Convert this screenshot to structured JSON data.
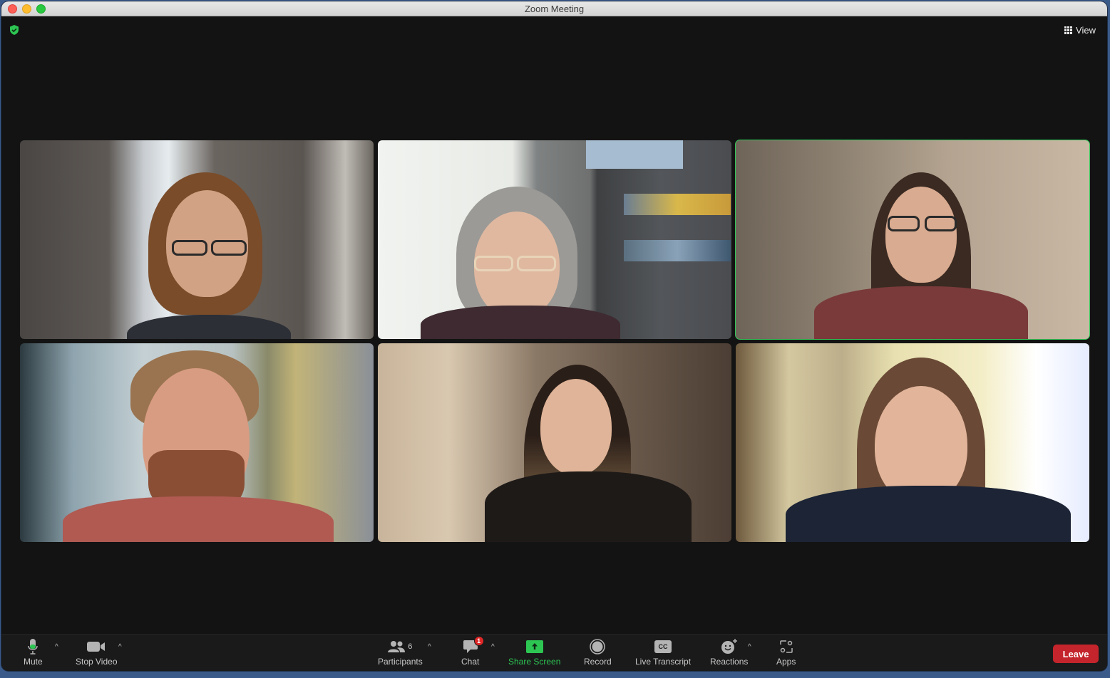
{
  "window": {
    "title": "Zoom Meeting",
    "traffic_lights": [
      "close",
      "minimize",
      "maximize"
    ]
  },
  "header": {
    "security_icon": "shield-check-icon",
    "security_color": "#2dc653",
    "view_label": "View",
    "view_icon": "grid-icon"
  },
  "participants": [
    {
      "position": "top-left",
      "speaking": false,
      "description": "woman with brown hair and glasses"
    },
    {
      "position": "top-center",
      "speaking": false,
      "description": "woman with gray hair, glasses and headphones"
    },
    {
      "position": "top-right",
      "speaking": true,
      "description": "woman with long dark hair and glasses"
    },
    {
      "position": "bottom-left",
      "speaking": false,
      "description": "man with beard"
    },
    {
      "position": "bottom-center",
      "speaking": false,
      "description": "woman with long ombre hair"
    },
    {
      "position": "bottom-right",
      "speaking": false,
      "description": "woman with long brown hair"
    }
  ],
  "active_speaker_color": "#34c759",
  "toolbar": {
    "mute_label": "Mute",
    "stop_video_label": "Stop Video",
    "participants_label": "Participants",
    "participants_count": "6",
    "chat_label": "Chat",
    "chat_unread": "1",
    "share_screen_label": "Share Screen",
    "record_label": "Record",
    "live_transcript_label": "Live Transcript",
    "live_transcript_icon_text": "CC",
    "reactions_label": "Reactions",
    "apps_label": "Apps",
    "leave_label": "Leave",
    "caret": "^"
  },
  "colors": {
    "share_green": "#2dc653",
    "leave_red": "#c4242b",
    "badge_red": "#e02828"
  }
}
